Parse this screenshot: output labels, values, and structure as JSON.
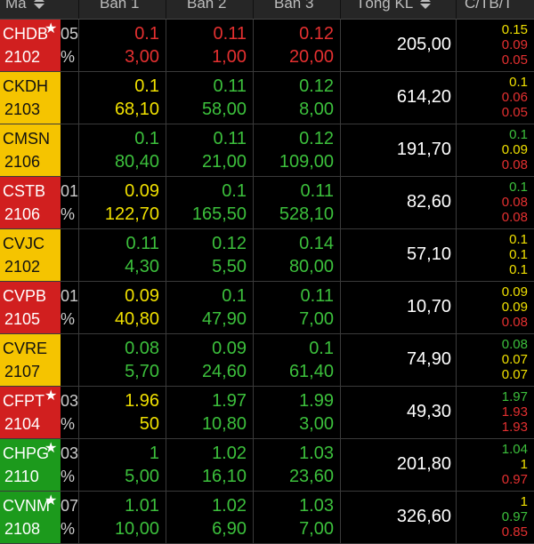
{
  "header": {
    "symbol": "Mã",
    "ban1": "Bán 1",
    "ban2": "Bán 2",
    "ban3": "Bán 3",
    "total": "Tổng KL",
    "ctbt": "C/TB/T"
  },
  "colors": {
    "red": "#e53030",
    "yellow": "#f0e000",
    "green": "#3cc03c",
    "cell_red": "#d11f1f",
    "cell_yellow": "#f5c400",
    "cell_green": "#1c9a1c"
  },
  "rows": [
    {
      "sym1": "CHDB",
      "sym2": "2102",
      "star": true,
      "bg": "red",
      "u1": "05",
      "u2": "%",
      "b1p": "0.1",
      "b1v": "3,00",
      "b1c": "red",
      "b2p": "0.11",
      "b2v": "1,00",
      "b2c": "red",
      "b3p": "0.12",
      "b3v": "20,00",
      "b3c": "red",
      "total": "205,00",
      "c": "0.15",
      "cc": "yellow",
      "tb": "0.09",
      "tbc": "red",
      "t": "0.05",
      "tc": "red"
    },
    {
      "sym1": "CKDH",
      "sym2": "2103",
      "star": false,
      "bg": "yellow",
      "u1": "",
      "u2": "",
      "b1p": "0.1",
      "b1v": "68,10",
      "b1c": "yellow",
      "b2p": "0.11",
      "b2v": "58,00",
      "b2c": "green",
      "b3p": "0.12",
      "b3v": "8,00",
      "b3c": "green",
      "total": "614,20",
      "c": "0.1",
      "cc": "yellow",
      "tb": "0.06",
      "tbc": "red",
      "t": "0.05",
      "tc": "red"
    },
    {
      "sym1": "CMSN",
      "sym2": "2106",
      "star": false,
      "bg": "yellow",
      "u1": "",
      "u2": "",
      "b1p": "0.1",
      "b1v": "80,40",
      "b1c": "green",
      "b2p": "0.11",
      "b2v": "21,00",
      "b2c": "green",
      "b3p": "0.12",
      "b3v": "109,00",
      "b3c": "green",
      "total": "191,70",
      "c": "0.1",
      "cc": "green",
      "tb": "0.09",
      "tbc": "yellow",
      "t": "0.08",
      "tc": "red"
    },
    {
      "sym1": "CSTB",
      "sym2": "2106",
      "star": false,
      "bg": "red",
      "u1": "01",
      "u2": "%",
      "b1p": "0.09",
      "b1v": "122,70",
      "b1c": "yellow",
      "b2p": "0.1",
      "b2v": "165,50",
      "b2c": "green",
      "b3p": "0.11",
      "b3v": "528,10",
      "b3c": "green",
      "total": "82,60",
      "c": "0.1",
      "cc": "green",
      "tb": "0.08",
      "tbc": "red",
      "t": "0.08",
      "tc": "red"
    },
    {
      "sym1": "CVJC",
      "sym2": "2102",
      "star": false,
      "bg": "yellow",
      "u1": "",
      "u2": "",
      "b1p": "0.11",
      "b1v": "4,30",
      "b1c": "green",
      "b2p": "0.12",
      "b2v": "5,50",
      "b2c": "green",
      "b3p": "0.14",
      "b3v": "80,00",
      "b3c": "green",
      "total": "57,10",
      "c": "0.1",
      "cc": "yellow",
      "tb": "0.1",
      "tbc": "yellow",
      "t": "0.1",
      "tc": "yellow"
    },
    {
      "sym1": "CVPB",
      "sym2": "2105",
      "star": false,
      "bg": "red",
      "u1": "01",
      "u2": "%",
      "b1p": "0.09",
      "b1v": "40,80",
      "b1c": "yellow",
      "b2p": "0.1",
      "b2v": "47,90",
      "b2c": "green",
      "b3p": "0.11",
      "b3v": "7,00",
      "b3c": "green",
      "total": "10,70",
      "c": "0.09",
      "cc": "yellow",
      "tb": "0.09",
      "tbc": "yellow",
      "t": "0.08",
      "tc": "red"
    },
    {
      "sym1": "CVRE",
      "sym2": "2107",
      "star": false,
      "bg": "yellow",
      "u1": "",
      "u2": "",
      "b1p": "0.08",
      "b1v": "5,70",
      "b1c": "green",
      "b2p": "0.09",
      "b2v": "24,60",
      "b2c": "green",
      "b3p": "0.1",
      "b3v": "61,40",
      "b3c": "green",
      "total": "74,90",
      "c": "0.08",
      "cc": "green",
      "tb": "0.07",
      "tbc": "yellow",
      "t": "0.07",
      "tc": "yellow"
    },
    {
      "sym1": "CFPT",
      "sym2": "2104",
      "star": true,
      "bg": "red",
      "u1": "03",
      "u2": "%",
      "b1p": "1.96",
      "b1v": "50",
      "b1c": "yellow",
      "b2p": "1.97",
      "b2v": "10,80",
      "b2c": "green",
      "b3p": "1.99",
      "b3v": "3,00",
      "b3c": "green",
      "total": "49,30",
      "c": "1.97",
      "cc": "green",
      "tb": "1.93",
      "tbc": "red",
      "t": "1.93",
      "tc": "red"
    },
    {
      "sym1": "CHPG",
      "sym2": "2110",
      "star": true,
      "bg": "green",
      "u1": "03",
      "u2": "%",
      "b1p": "1",
      "b1v": "5,00",
      "b1c": "green",
      "b2p": "1.02",
      "b2v": "16,10",
      "b2c": "green",
      "b3p": "1.03",
      "b3v": "23,60",
      "b3c": "green",
      "total": "201,80",
      "c": "1.04",
      "cc": "green",
      "tb": "1",
      "tbc": "yellow",
      "t": "0.97",
      "tc": "red"
    },
    {
      "sym1": "CVNM",
      "sym2": "2108",
      "star": true,
      "bg": "green",
      "u1": "07",
      "u2": "%",
      "b1p": "1.01",
      "b1v": "10,00",
      "b1c": "green",
      "b2p": "1.02",
      "b2v": "6,90",
      "b2c": "green",
      "b3p": "1.03",
      "b3v": "7,00",
      "b3c": "green",
      "total": "326,60",
      "c": "1",
      "cc": "yellow",
      "tb": "0.97",
      "tbc": "green",
      "t": "0.85",
      "tc": "red"
    }
  ]
}
